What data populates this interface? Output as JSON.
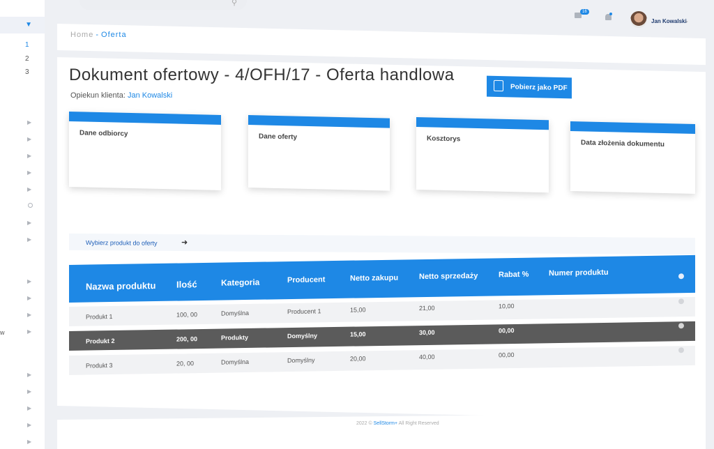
{
  "sidebar": {
    "numbers": [
      "1",
      "2",
      "3"
    ],
    "partial_label": "w"
  },
  "topbar": {
    "mail_count": "16",
    "user_name": "Jan Kowalski"
  },
  "breadcrumb": {
    "home": "Home",
    "separator": "-",
    "current": "Oferta"
  },
  "page": {
    "title": "Dokument ofertowy - 4/OFH/17 - Oferta handlowa",
    "client_label": "Opiekun klienta:",
    "client_name": "Jan Kowalski",
    "pdf_button": "Pobierz jako PDF"
  },
  "cards": [
    "Dane odbiorcy",
    "Dane oferty",
    "Kosztorys",
    "Data złożenia dokumentu"
  ],
  "product_select": {
    "label": "Wybierz produkt do oferty"
  },
  "table": {
    "headers": [
      "Nazwa produktu",
      "Ilość",
      "Kategoria",
      "Producent",
      "Netto zakupu",
      "Netto sprzedaży",
      "Rabat %",
      "Numer produktu"
    ],
    "rows": [
      [
        "Produkt 1",
        "100, 00",
        "Domyślna",
        "Producent 1",
        "15,00",
        "21,00",
        "10,00"
      ],
      [
        "Produkt 2",
        "200, 00",
        "Produkty",
        "Domyślny",
        "15,00",
        "30,00",
        "00,00"
      ],
      [
        "Produkt 3",
        "20, 00",
        "Domyślna",
        "Domyślny",
        "20,00",
        "40,00",
        "00,00"
      ]
    ]
  },
  "footer": {
    "year": "2022 ©",
    "brand": "SellStorm+",
    "rights": "All Right Reserved"
  },
  "colors": {
    "accent": "#1e88e5",
    "selected_row": "#5b5b5b"
  }
}
